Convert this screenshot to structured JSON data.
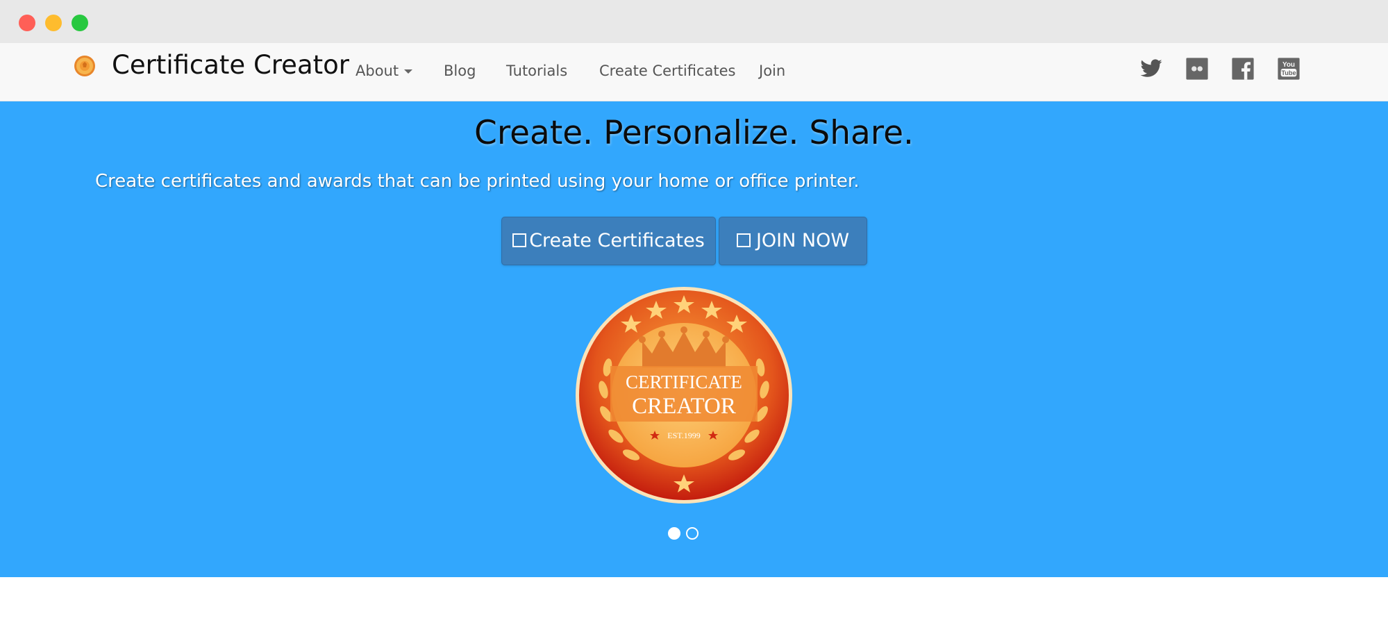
{
  "brand": {
    "name": "Certificate Creator",
    "logo_icon": "medal-icon"
  },
  "nav": {
    "items": [
      {
        "label": "About",
        "has_dropdown": true
      },
      {
        "label": "Blog"
      },
      {
        "label": "Tutorials"
      },
      {
        "label": "Create Certificates"
      },
      {
        "label": "Join"
      }
    ]
  },
  "social": [
    {
      "name": "twitter-icon"
    },
    {
      "name": "flickr-icon"
    },
    {
      "name": "facebook-icon"
    },
    {
      "name": "youtube-icon",
      "text": "You Tube"
    }
  ],
  "hero": {
    "title": "Create. Personalize. Share.",
    "subtitle": "Create certificates and awards that can be printed using your home or office printer.",
    "buttons": [
      {
        "label": "Create Certificates",
        "icon": "square-icon"
      },
      {
        "label": "JOIN NOW",
        "icon": "square-icon"
      }
    ],
    "seal": {
      "line1": "CERTIFICATE",
      "line2": "CREATOR",
      "est": "EST.1999"
    },
    "carousel": {
      "slides": 2,
      "active": 1
    }
  },
  "colors": {
    "hero_bg": "#32a7fd",
    "button_bg": "#3c7fbc",
    "navbar_bg": "#f8f8f8",
    "seal_orange": "#f28a1e",
    "seal_red": "#c7210f",
    "seal_gold": "#fcc266"
  }
}
